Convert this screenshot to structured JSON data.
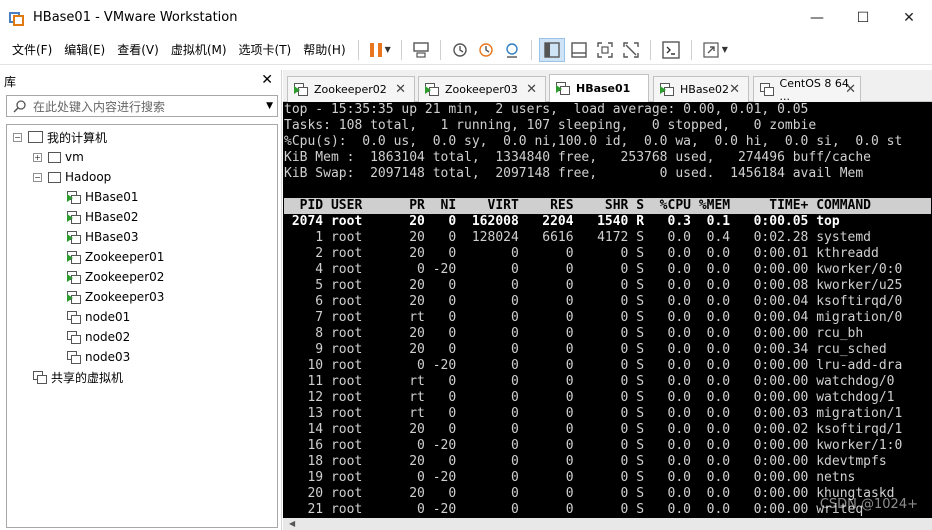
{
  "window": {
    "title": "HBase01 - VMware Workstation",
    "minimize": "—",
    "maximize": "☐",
    "close": "✕"
  },
  "menu": {
    "items": [
      "文件(F)",
      "编辑(E)",
      "查看(V)",
      "虚拟机(M)",
      "选项卡(T)",
      "帮助(H)"
    ]
  },
  "library": {
    "title": "库",
    "close": "✕",
    "search_placeholder": "在此处键入内容进行搜索",
    "tree": {
      "my_computer": "我的计算机",
      "vm": "vm",
      "hadoop": "Hadoop",
      "hadoop_children": [
        "HBase01",
        "HBase02",
        "HBase03",
        "Zookeeper01",
        "Zookeeper02",
        "Zookeeper03",
        "node01",
        "node02",
        "node03"
      ],
      "shared": "共享的虚拟机"
    }
  },
  "tabs": [
    {
      "label": "Zookeeper02",
      "active": false
    },
    {
      "label": "Zookeeper03",
      "active": false
    },
    {
      "label": "HBase01",
      "active": true
    },
    {
      "label": "HBase02",
      "active": false
    },
    {
      "label": "CentOS 8 64 ...",
      "active": false
    }
  ],
  "terminal": {
    "summary": [
      "top - 15:35:35 up 21 min,  2 users,  load average: 0.00, 0.01, 0.05",
      "Tasks: 108 total,   1 running, 107 sleeping,   0 stopped,   0 zombie",
      "%Cpu(s):  0.0 us,  0.0 sy,  0.0 ni,100.0 id,  0.0 wa,  0.0 hi,  0.0 si,  0.0 st",
      "KiB Mem :  1863104 total,  1334840 free,   253768 used,   274496 buff/cache",
      "KiB Swap:  2097148 total,  2097148 free,        0 used.  1456184 avail Mem"
    ],
    "header": "  PID USER      PR  NI    VIRT    RES    SHR S  %CPU %MEM     TIME+ COMMAND     ",
    "processes": [
      " 2074 root      20   0  162008   2204   1540 R   0.3  0.1   0:00.05 top",
      "    1 root      20   0  128024   6616   4172 S   0.0  0.4   0:02.28 systemd",
      "    2 root      20   0       0      0      0 S   0.0  0.0   0:00.01 kthreadd",
      "    4 root       0 -20       0      0      0 S   0.0  0.0   0:00.00 kworker/0:0",
      "    5 root      20   0       0      0      0 S   0.0  0.0   0:00.08 kworker/u25",
      "    6 root      20   0       0      0      0 S   0.0  0.0   0:00.04 ksoftirqd/0",
      "    7 root      rt   0       0      0      0 S   0.0  0.0   0:00.04 migration/0",
      "    8 root      20   0       0      0      0 S   0.0  0.0   0:00.00 rcu_bh",
      "    9 root      20   0       0      0      0 S   0.0  0.0   0:00.34 rcu_sched",
      "   10 root       0 -20       0      0      0 S   0.0  0.0   0:00.00 lru-add-dra",
      "   11 root      rt   0       0      0      0 S   0.0  0.0   0:00.00 watchdog/0",
      "   12 root      rt   0       0      0      0 S   0.0  0.0   0:00.00 watchdog/1",
      "   13 root      rt   0       0      0      0 S   0.0  0.0   0:00.03 migration/1",
      "   14 root      20   0       0      0      0 S   0.0  0.0   0:00.02 ksoftirqd/1",
      "   16 root       0 -20       0      0      0 S   0.0  0.0   0:00.00 kworker/1:0",
      "   18 root      20   0       0      0      0 S   0.0  0.0   0:00.00 kdevtmpfs",
      "   19 root       0 -20       0      0      0 S   0.0  0.0   0:00.00 netns",
      "   20 root      20   0       0      0      0 S   0.0  0.0   0:00.00 khungtaskd",
      "   21 root       0 -20       0      0      0 S   0.0  0.0   0:00.00 writeq"
    ]
  },
  "watermark": "CSDN @1024+",
  "colors": {
    "accent_active": "#cfe3f7",
    "pause_orange": "#e8761e",
    "vm_play_green": "#2d9b2d",
    "terminal_bg": "#000000",
    "terminal_fg": "#d0d0d0"
  }
}
